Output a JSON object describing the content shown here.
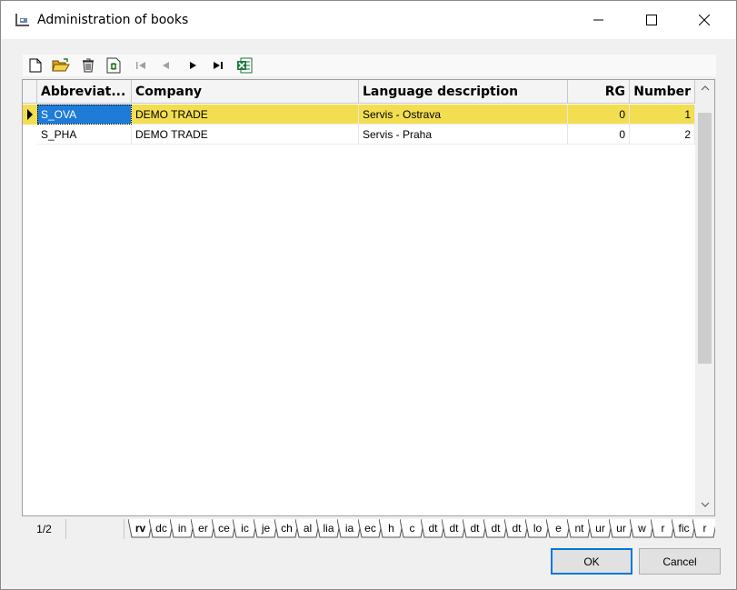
{
  "window": {
    "title": "Administration of books"
  },
  "grid": {
    "columns": [
      {
        "label": "Abbreviat...",
        "align": "left"
      },
      {
        "label": "Company",
        "align": "left"
      },
      {
        "label": "Language description",
        "align": "left"
      },
      {
        "label": "RG",
        "align": "right"
      },
      {
        "label": "Number",
        "align": "right"
      }
    ],
    "rows": [
      {
        "abbreviation": "S_OVA",
        "company": "DEMO TRADE",
        "language": "Servis - Ostrava",
        "rg": "0",
        "number": "1",
        "selected": true
      },
      {
        "abbreviation": "S_PHA",
        "company": "DEMO TRADE",
        "language": "Servis - Praha",
        "rg": "0",
        "number": "2",
        "selected": false
      }
    ]
  },
  "status": {
    "counter": "1/2"
  },
  "tabs": [
    "rv",
    "dc",
    "in",
    "er",
    "ce",
    "ic",
    "je",
    "ch",
    "al",
    "lia",
    "ia",
    "ec",
    "h",
    "c",
    "dt",
    "dt",
    "dt",
    "dt",
    "dt",
    "lo",
    "e",
    "nt",
    "ur",
    "ur",
    "w",
    "r",
    "fic",
    "r"
  ],
  "buttons": {
    "ok": "OK",
    "cancel": "Cancel"
  },
  "colors": {
    "selected_row": "#f2de50",
    "focus_cell": "#1f7bd8",
    "ok_border": "#0078d7"
  }
}
